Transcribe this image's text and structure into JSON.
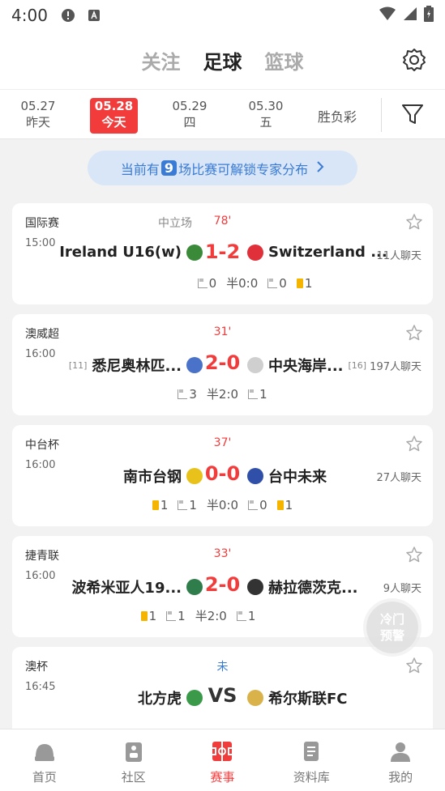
{
  "status": {
    "time": "4:00"
  },
  "header": {
    "tabs": [
      "关注",
      "足球",
      "篮球"
    ],
    "active_tab": "足球"
  },
  "dates": [
    {
      "line1": "05.27",
      "line2": "昨天",
      "active": false
    },
    {
      "line1": "05.28",
      "line2": "今天",
      "active": true
    },
    {
      "line1": "05.29",
      "line2": "四",
      "active": false
    },
    {
      "line1": "05.30",
      "line2": "五",
      "active": false
    }
  ],
  "lottery_label": "胜负彩",
  "banner": {
    "prefix": "当前有",
    "count": "9",
    "suffix": "场比赛可解锁专家分布"
  },
  "matches": [
    {
      "league": "国际赛",
      "time": "15:00",
      "neutral": "中立场",
      "minute": "78'",
      "home": "Ireland  U16(w)",
      "away": "Switzerland ...",
      "score": "1-2",
      "chat": "11人聊天",
      "stats": {
        "h_corner": "0",
        "half": "半0:0",
        "a_corner": "0",
        "a_yellow": "1"
      }
    },
    {
      "league": "澳威超",
      "time": "16:00",
      "minute": "31'",
      "home_rank": "[11]",
      "home": "悉尼奥林匹...",
      "away": "中央海岸...",
      "away_rank": "[16]",
      "score": "2-0",
      "chat": "197人聊天",
      "stats": {
        "h_corner": "3",
        "half": "半2:0",
        "a_corner": "1"
      }
    },
    {
      "league": "中台杯",
      "time": "16:00",
      "minute": "37'",
      "home": "南市台钢",
      "away": "台中未来",
      "score": "0-0",
      "chat": "27人聊天",
      "stats": {
        "h_yellow": "1",
        "h_corner": "1",
        "half": "半0:0",
        "a_corner": "0",
        "a_yellow": "1"
      }
    },
    {
      "league": "捷青联",
      "time": "16:00",
      "minute": "33'",
      "home": "波希米亚人19...",
      "away": "赫拉德茨克...",
      "score": "2-0",
      "chat": "9人聊天",
      "stats": {
        "h_yellow": "1",
        "h_corner": "1",
        "half": "半2:0",
        "a_corner": "1"
      }
    },
    {
      "league": "澳杯",
      "time": "16:45",
      "minute": "未",
      "home": "北方虎",
      "away": "希尔斯联FC",
      "score": "VS"
    }
  ],
  "float_button": {
    "line1": "冷门",
    "line2": "预警"
  },
  "tabbar": [
    {
      "label": "首页",
      "icon": "home-icon",
      "active": false
    },
    {
      "label": "社区",
      "icon": "community-icon",
      "active": false
    },
    {
      "label": "赛事",
      "icon": "match-icon",
      "active": true
    },
    {
      "label": "资料库",
      "icon": "database-icon",
      "active": false
    },
    {
      "label": "我的",
      "icon": "profile-icon",
      "active": false
    }
  ],
  "colors": {
    "accent": "#f23c3c",
    "blue": "#3a7bd5",
    "yellow_card": "#f5b400"
  }
}
